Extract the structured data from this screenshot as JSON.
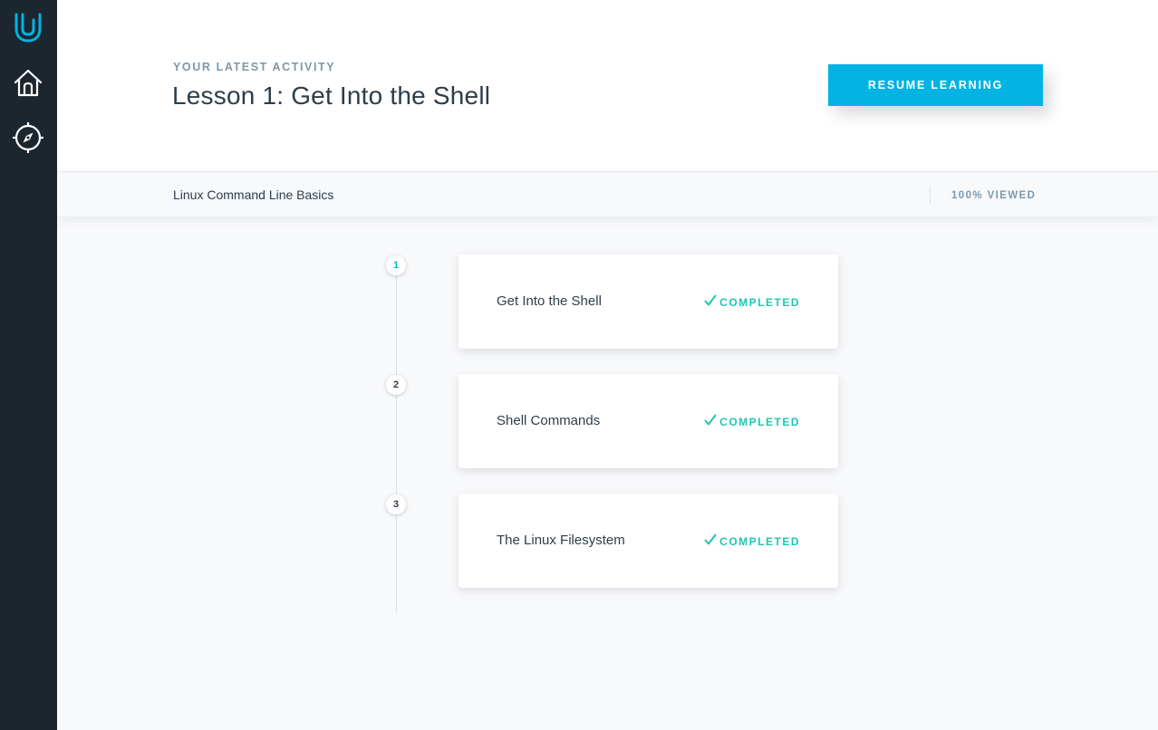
{
  "sidebar": {
    "icons": [
      "udacity-logo-icon",
      "home-icon",
      "compass-icon"
    ]
  },
  "header": {
    "eyebrow": "YOUR LATEST ACTIVITY",
    "title": "Lesson 1: Get Into the Shell",
    "resume_label": "RESUME LEARNING"
  },
  "subbar": {
    "course_name": "Linux Command Line Basics",
    "viewed": "100% VIEWED"
  },
  "lessons": [
    {
      "number": "1",
      "title": "Get Into the Shell",
      "status": "COMPLETED"
    },
    {
      "number": "2",
      "title": "Shell Commands",
      "status": "COMPLETED"
    },
    {
      "number": "3",
      "title": "The Linux Filesystem",
      "status": "COMPLETED"
    }
  ],
  "colors": {
    "accent": "#02b3e4",
    "sidebar": "#1c262f",
    "completed": "#1cc7b3",
    "text": "#2e3d49",
    "muted": "#7d97ad"
  }
}
